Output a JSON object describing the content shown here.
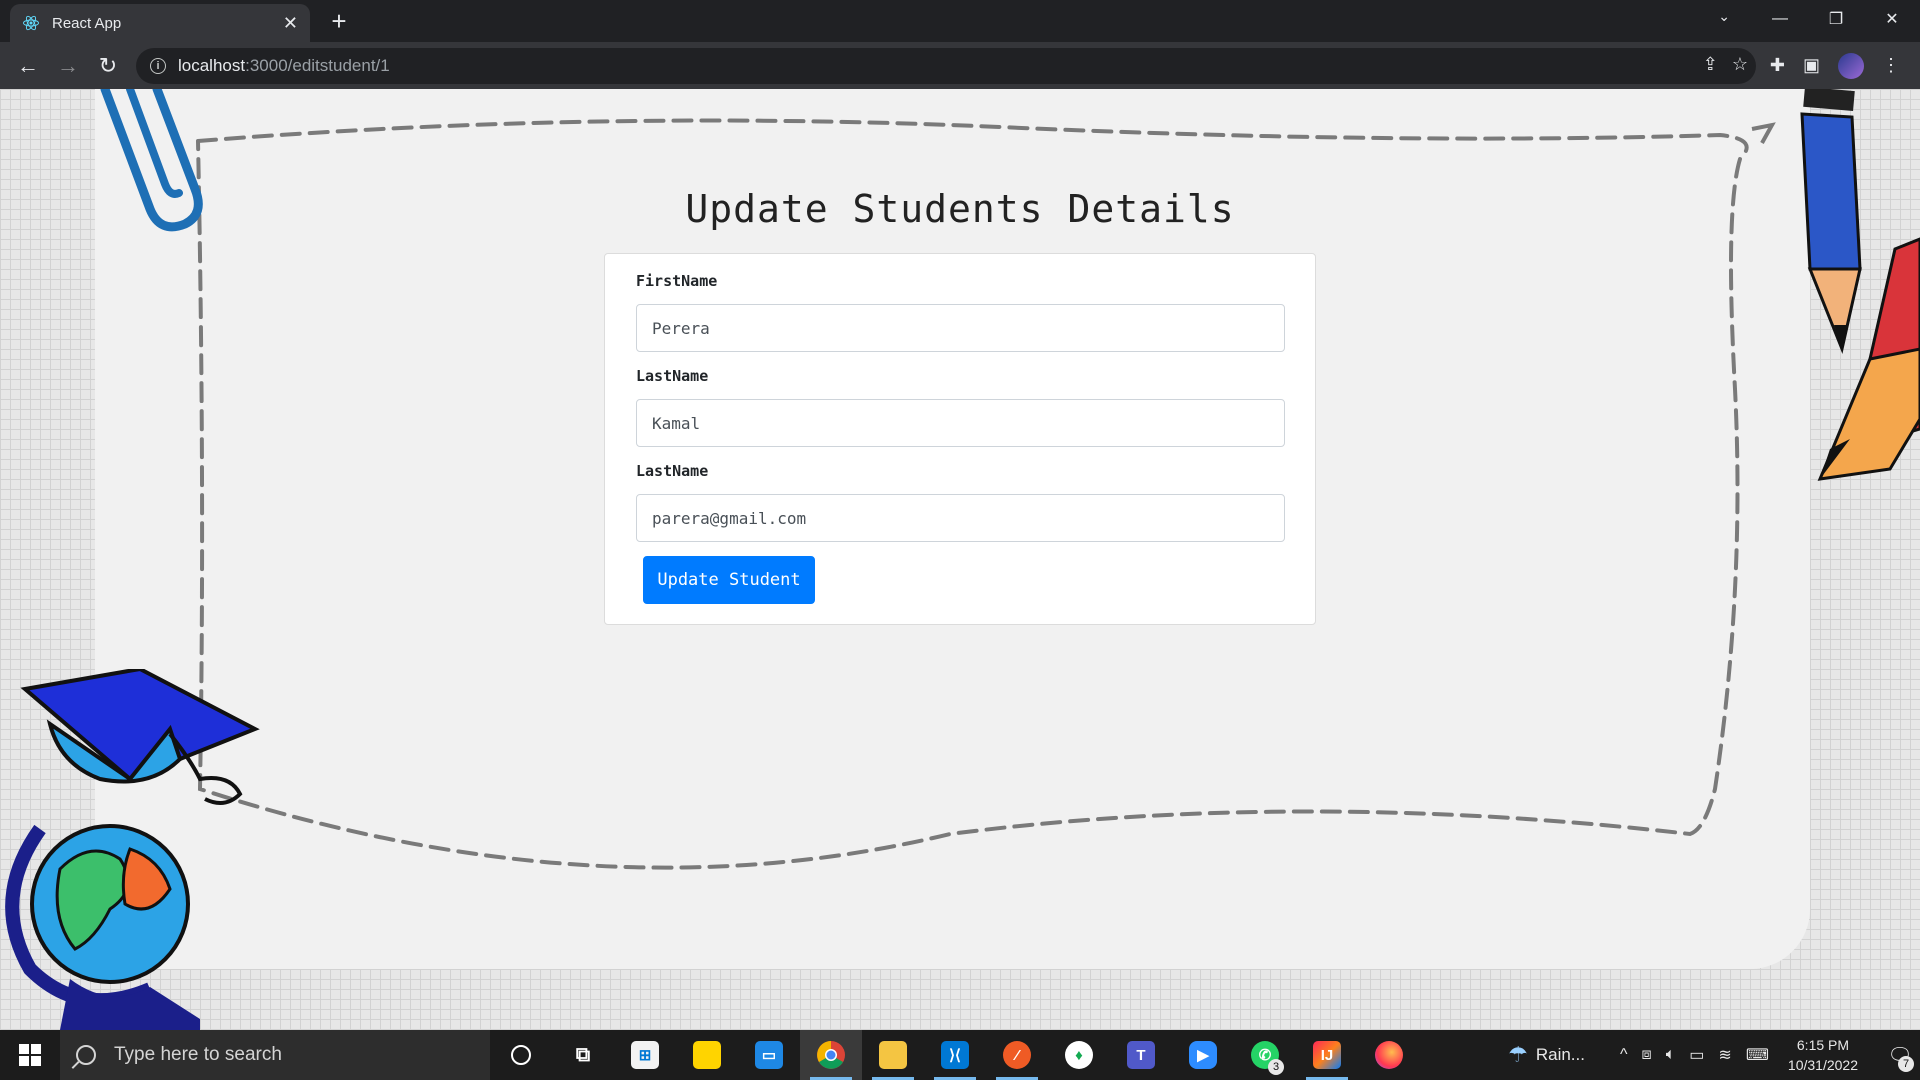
{
  "browser": {
    "tab_title": "React App",
    "tab_close": "✕",
    "new_tab": "+",
    "url_host": "localhost",
    "url_path": ":3000/editstudent/1"
  },
  "page": {
    "title": "Update Students Details",
    "form": {
      "first_label": "FirstName",
      "first_value": "Perera",
      "last_label": "LastName",
      "last_value": "Kamal",
      "email_label": "LastName",
      "email_value": "parera@gmail.com",
      "submit_label": "Update Student"
    }
  },
  "taskbar": {
    "search_placeholder": "Type here to search",
    "weather": "Rain...",
    "time": "6:15 PM",
    "date": "10/31/2022",
    "whatsapp_badge": "3",
    "notification_badge": "7",
    "apps": [
      "cortana",
      "task-view",
      "microsoft-store",
      "sticky-notes",
      "laptop-app",
      "chrome",
      "file-explorer",
      "vscode",
      "postman",
      "mongodb-compass",
      "teams",
      "zoom",
      "whatsapp",
      "intellij",
      "firefox"
    ]
  },
  "colors": {
    "accent_button": "#007bff",
    "browser_bg": "#202124",
    "toolbar_bg": "#35363a",
    "taskbar_bg": "#1c1c1c"
  }
}
